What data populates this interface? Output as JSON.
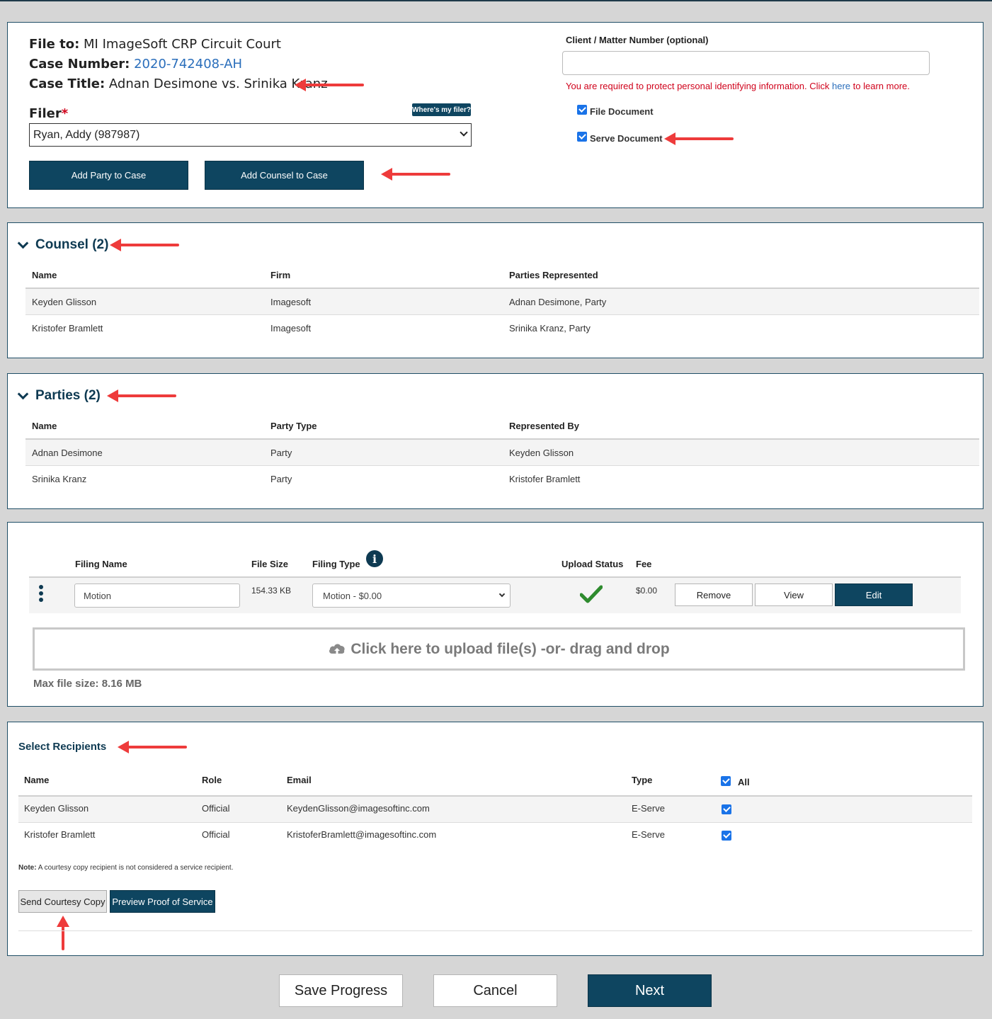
{
  "case": {
    "file_to_label": "File to:",
    "file_to_value": "MI ImageSoft CRP Circuit Court",
    "case_number_label": "Case Number:",
    "case_number_value": "2020-742408-AH",
    "case_title_label": "Case Title:",
    "case_title_value": "Adnan Desimone vs. Srinika Kranz",
    "filer_label": "Filer",
    "filer_required": "*",
    "wheres_my_filer": "Where's my filer?",
    "filer_value": "Ryan, Addy (987987)",
    "add_party_button": "Add Party to Case",
    "add_counsel_button": "Add Counsel to Case",
    "client_matter_label": "Client / Matter Number (optional)",
    "client_matter_value": "",
    "pii_notice_pre": "You are required to protect personal identifying information. Click ",
    "pii_notice_link": "here",
    "pii_notice_post": " to learn more.",
    "file_document_label": "File Document",
    "serve_document_label": "Serve Document"
  },
  "counsel": {
    "title": "Counsel (2)",
    "headers": [
      "Name",
      "Firm",
      "Parties Represented"
    ],
    "rows": [
      [
        "Keyden Glisson",
        "Imagesoft",
        "Adnan Desimone, Party"
      ],
      [
        "Kristofer Bramlett",
        "Imagesoft",
        "Srinika Kranz, Party"
      ]
    ]
  },
  "parties": {
    "title": "Parties (2)",
    "headers": [
      "Name",
      "Party Type",
      "Represented By"
    ],
    "rows": [
      [
        "Adnan Desimone",
        "Party",
        "Keyden Glisson"
      ],
      [
        "Srinika Kranz",
        "Party",
        "Kristofer Bramlett"
      ]
    ]
  },
  "filings": {
    "headers": {
      "filing_name": "Filing Name",
      "file_size": "File Size",
      "filing_type": "Filing Type",
      "upload_status": "Upload Status",
      "fee": "Fee"
    },
    "row": {
      "filing_name": "Motion",
      "file_size": "154.33 KB",
      "filing_type": "Motion - $0.00",
      "fee": "$0.00",
      "remove": "Remove",
      "view": "View",
      "edit": "Edit"
    },
    "upload_prompt": "Click here to upload file(s) -or- drag and drop",
    "max_file_size": "Max file size: 8.16 MB"
  },
  "recipients": {
    "title": "Select Recipients",
    "headers": [
      "Name",
      "Role",
      "Email",
      "Type"
    ],
    "all_label": "All",
    "rows": [
      [
        "Keyden Glisson",
        "Official",
        "KeydenGlisson@imagesoftinc.com",
        "E-Serve"
      ],
      [
        "Kristofer Bramlett",
        "Official",
        "KristoferBramlett@imagesoftinc.com",
        "E-Serve"
      ]
    ],
    "note_label": "Note:",
    "note_text": " A courtesy copy recipient is not considered a service recipient.",
    "send_courtesy_copy": "Send Courtesy Copy",
    "preview_proof": "Preview Proof of Service"
  },
  "footer": {
    "save_progress": "Save Progress",
    "cancel": "Cancel",
    "next": "Next"
  },
  "colors": {
    "navy": "#0e4560",
    "accent_blue": "#2a6ebb",
    "error_red": "#d0021b",
    "annotation_red": "#ee3b3b",
    "success_green": "#2e8b2e"
  }
}
